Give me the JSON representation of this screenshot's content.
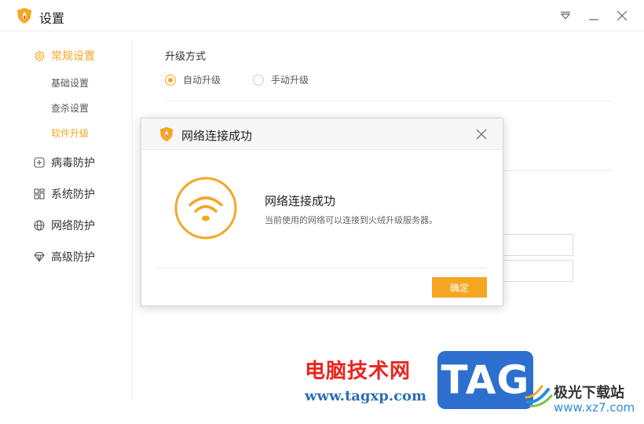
{
  "window": {
    "title": "设置"
  },
  "sidebar": {
    "groups": [
      {
        "label": "常规设置",
        "icon": "gear-icon",
        "active": true
      },
      {
        "label": "病毒防护",
        "icon": "plus-square-icon",
        "active": false
      },
      {
        "label": "系统防护",
        "icon": "grid-icon",
        "active": false
      },
      {
        "label": "网络防护",
        "icon": "globe-icon",
        "active": false
      },
      {
        "label": "高级防护",
        "icon": "diamond-icon",
        "active": false
      }
    ],
    "subitems": [
      {
        "label": "基础设置",
        "active": false
      },
      {
        "label": "查杀设置",
        "active": false
      },
      {
        "label": "软件升级",
        "active": true
      }
    ]
  },
  "upgrade": {
    "section_title": "升级方式",
    "options": [
      {
        "label": "自动升级",
        "checked": true
      },
      {
        "label": "手动升级",
        "checked": false
      }
    ]
  },
  "dialog": {
    "title": "网络连接成功",
    "heading": "网络连接成功",
    "description": "当前使用的网络可以连接到火绒升级服务器。",
    "confirm_label": "确定"
  },
  "watermark": {
    "site_name": "电脑技术网",
    "site_url": "www.tagxp.com",
    "tag_text": "TAG",
    "xz_title": "极光下载站",
    "xz_url": "www.xz7.com"
  },
  "colors": {
    "accent": "#f5a623",
    "brand_red": "#e8251d",
    "tag_blue": "#2d6fcf"
  }
}
